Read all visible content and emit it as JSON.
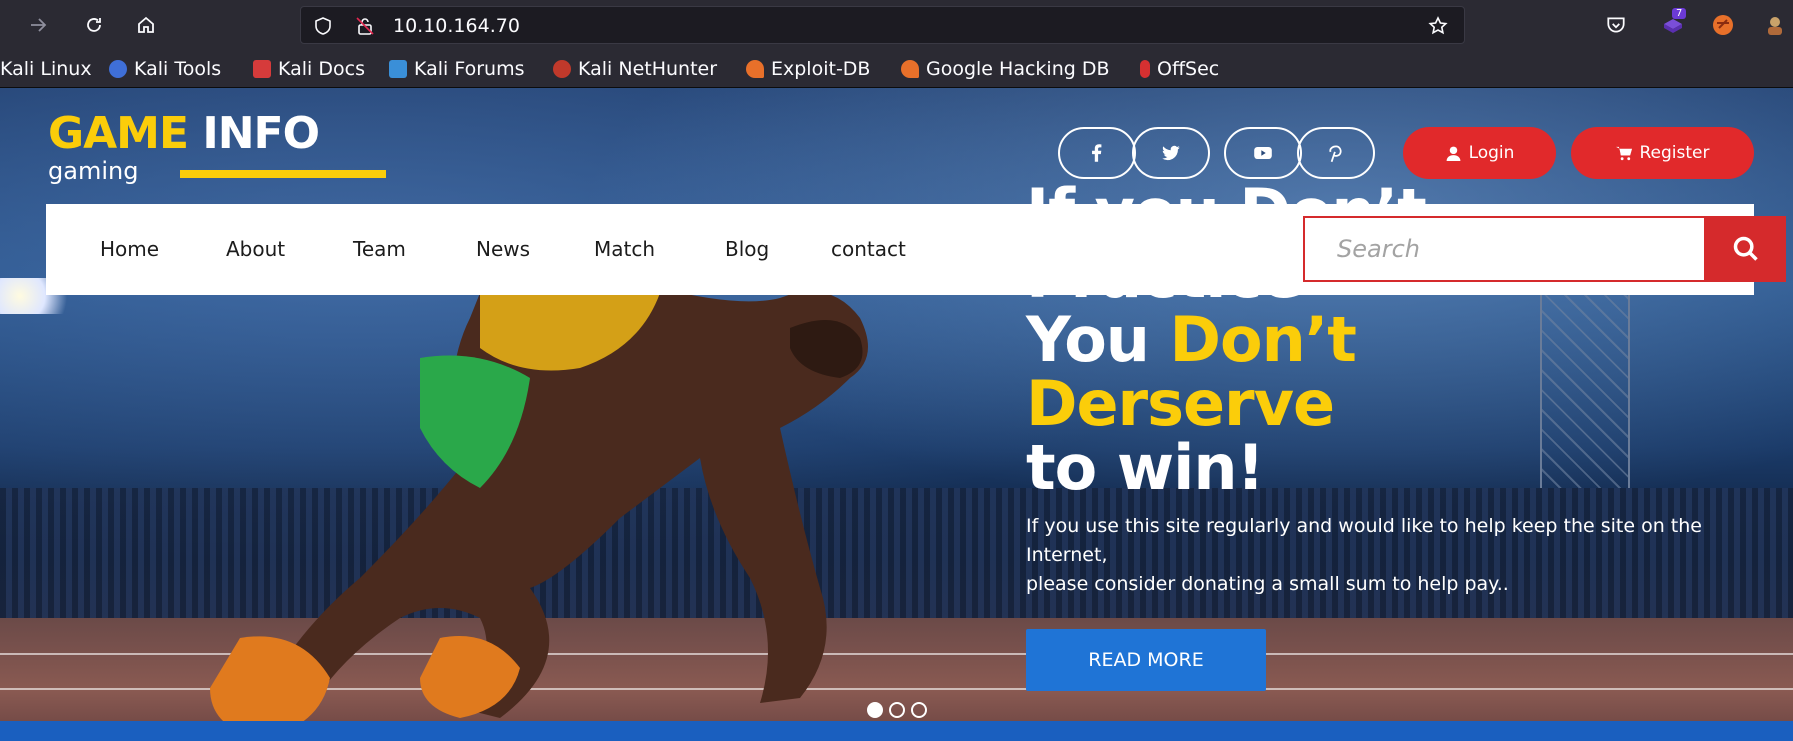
{
  "browser": {
    "url": "10.10.164.70",
    "extension_badge": "7",
    "bookmarks": [
      {
        "label": "Kali Linux",
        "color": "#2b2a33"
      },
      {
        "label": "Kali Tools",
        "color": "#3f6fd8"
      },
      {
        "label": "Kali Docs",
        "color": "#d63b3b"
      },
      {
        "label": "Kali Forums",
        "color": "#3a8fd8"
      },
      {
        "label": "Kali NetHunter",
        "color": "#c0392b"
      },
      {
        "label": "Exploit-DB",
        "color": "#e8702a"
      },
      {
        "label": "Google Hacking DB",
        "color": "#e8702a"
      },
      {
        "label": "OffSec",
        "color": "#d63031"
      }
    ]
  },
  "site": {
    "logo_main_yellow": "GAME",
    "logo_main_white": "INFO",
    "logo_sub": "gaming",
    "login_label": "Login",
    "register_label": "Register",
    "nav": [
      "Home",
      "About",
      "Team",
      "News",
      "Match",
      "Blog",
      "contact"
    ],
    "search_placeholder": "Search",
    "hero": {
      "line1": "If you Don’t",
      "line2": "Practice",
      "line3_white": "You",
      "line3_yellow": "Don’t",
      "line4_yellow": "Derserve",
      "line5": "to win!",
      "paragraph1": "If you use this site regularly and would like to help keep the site on the Internet,",
      "paragraph2": "please consider donating a small sum to help pay..",
      "button": "READ MORE"
    },
    "carousel": {
      "slides": 3,
      "active": 1
    },
    "colors": {
      "yellow": "#fbcd0a",
      "red": "#e1292b",
      "blue": "#1f74d6"
    }
  }
}
